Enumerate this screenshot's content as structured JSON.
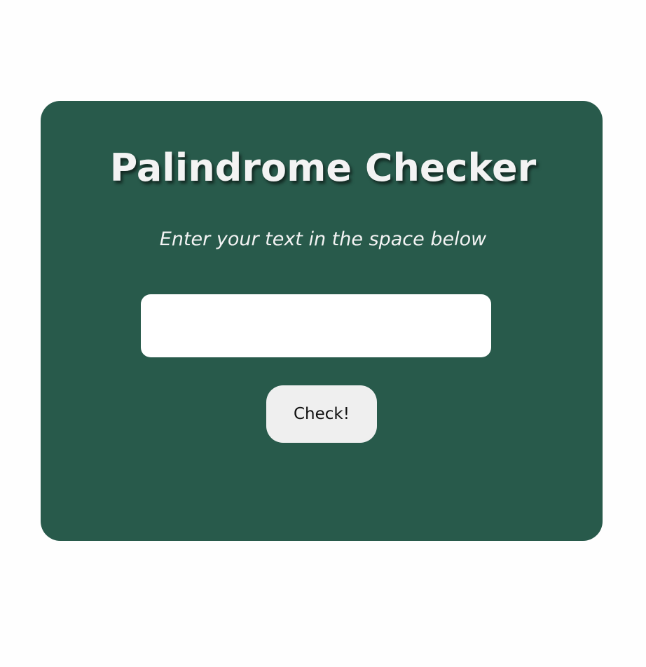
{
  "app": {
    "title": "Palindrome Checker",
    "subtitle": "Enter your text in the space below"
  },
  "form": {
    "input_value": "",
    "input_placeholder": "",
    "button_label": "Check!"
  },
  "colors": {
    "page_background": "#fefefe",
    "card_background": "#285a4b",
    "title_text": "#f3f3f3",
    "input_background": "#ffffff",
    "button_background": "#efefef",
    "button_text": "#111111"
  }
}
